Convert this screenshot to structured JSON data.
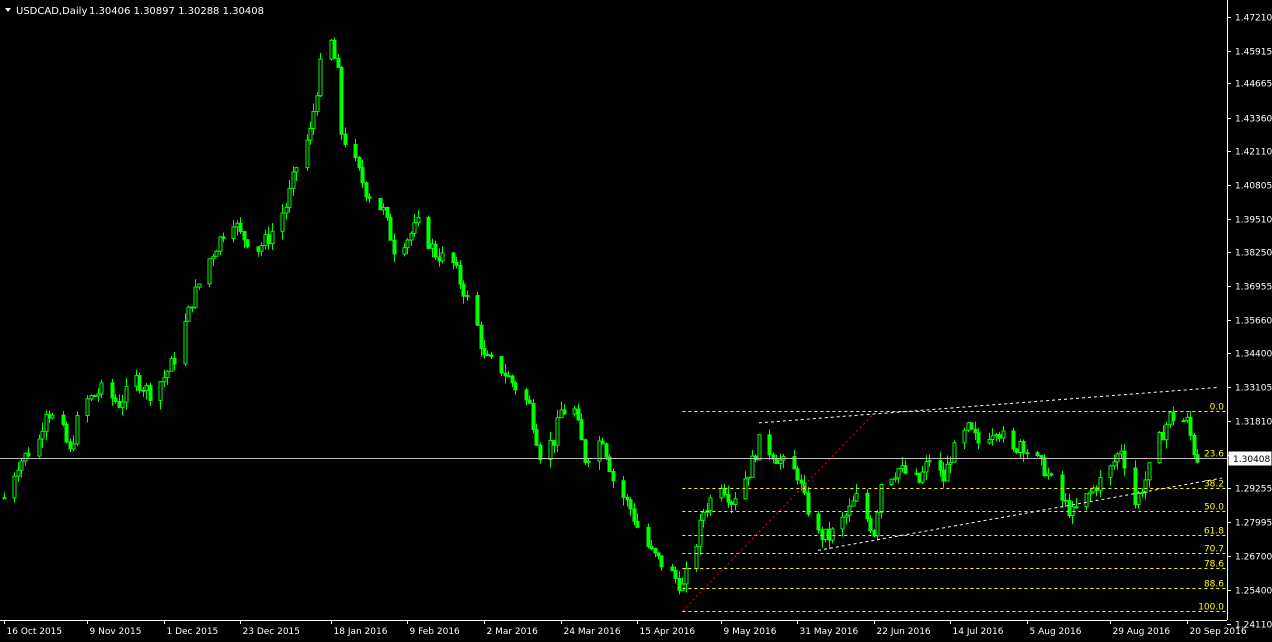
{
  "header": {
    "symbol": "USDCAD,Daily",
    "ohlc": "1.30406 1.30897 1.30288 1.30408",
    "menu_icon": "triangle-down-icon"
  },
  "colors": {
    "background": "#000000",
    "axis": "#ffffff",
    "bull_candle": "#00ff00",
    "fib": "#ffff00",
    "trendline": "#ffffff",
    "fib_base": "#ff0000",
    "current_price_line": "#c0c0c0"
  },
  "price_tag": "1.30408",
  "chart_data": {
    "type": "candlestick",
    "title": "",
    "xlabel": "",
    "ylabel": "",
    "ylim": [
      1.2425,
      1.4765
    ],
    "grid": false,
    "y_ticks": [
      "1.47210",
      "1.45915",
      "1.44665",
      "1.43360",
      "1.42110",
      "1.40805",
      "1.39510",
      "1.38250",
      "1.36955",
      "1.35660",
      "1.34400",
      "1.33105",
      "1.31810",
      "1.30515",
      "1.29255",
      "1.27995",
      "1.26700",
      "1.25400",
      "1.24110"
    ],
    "x_ticks": [
      "16 Oct 2015",
      "9 Nov 2015",
      "1 Dec 2015",
      "23 Dec 2015",
      "18 Jan 2016",
      "9 Feb 2016",
      "2 Mar 2016",
      "24 Mar 2016",
      "15 Apr 2016",
      "9 May 2016",
      "31 May 2016",
      "22 Jun 2016",
      "14 Jul 2016",
      "5 Aug 2016",
      "29 Aug 2016",
      "20 Sep 2016"
    ],
    "price_path": [
      [
        "16 Oct 2015",
        1.289
      ],
      [
        "20 Oct 2015",
        1.302
      ],
      [
        "26 Oct 2015",
        1.311
      ],
      [
        "28 Oct 2015",
        1.323
      ],
      [
        "2 Nov 2015",
        1.314
      ],
      [
        "4 Nov 2015",
        1.306
      ],
      [
        "6 Nov 2015",
        1.318
      ],
      [
        "9 Nov 2015",
        1.326
      ],
      [
        "13 Nov 2015",
        1.33
      ],
      [
        "18 Nov 2015",
        1.325
      ],
      [
        "23 Nov 2015",
        1.334
      ],
      [
        "27 Nov 2015",
        1.329
      ],
      [
        "1 Dec 2015",
        1.335
      ],
      [
        "4 Dec 2015",
        1.342
      ],
      [
        "9 Dec 2015",
        1.364
      ],
      [
        "14 Dec 2015",
        1.38
      ],
      [
        "18 Dec 2015",
        1.39
      ],
      [
        "21 Dec 2015",
        1.395
      ],
      [
        "23 Dec 2015",
        1.389
      ],
      [
        "28 Dec 2015",
        1.384
      ],
      [
        "31 Dec 2015",
        1.388
      ],
      [
        "5 Jan 2016",
        1.4
      ],
      [
        "8 Jan 2016",
        1.415
      ],
      [
        "12 Jan 2016",
        1.428
      ],
      [
        "15 Jan 2016",
        1.453
      ],
      [
        "18 Jan 2016",
        1.462
      ],
      [
        "20 Jan 2016",
        1.45
      ],
      [
        "21 Jan 2016",
        1.428
      ],
      [
        "25 Jan 2016",
        1.416
      ],
      [
        "28 Jan 2016",
        1.406
      ],
      [
        "2 Feb 2016",
        1.398
      ],
      [
        "5 Feb 2016",
        1.384
      ],
      [
        "9 Feb 2016",
        1.388
      ],
      [
        "12 Feb 2016",
        1.393
      ],
      [
        "17 Feb 2016",
        1.382
      ],
      [
        "22 Feb 2016",
        1.378
      ],
      [
        "25 Feb 2016",
        1.368
      ],
      [
        "29 Feb 2016",
        1.354
      ],
      [
        "2 Mar 2016",
        1.342
      ],
      [
        "7 Mar 2016",
        1.338
      ],
      [
        "10 Mar 2016",
        1.333
      ],
      [
        "15 Mar 2016",
        1.324
      ],
      [
        "18 Mar 2016",
        1.306
      ],
      [
        "22 Mar 2016",
        1.311
      ],
      [
        "24 Mar 2016",
        1.322
      ],
      [
        "28 Mar 2016",
        1.322
      ],
      [
        "31 Mar 2016",
        1.304
      ],
      [
        "5 Apr 2016",
        1.312
      ],
      [
        "8 Apr 2016",
        1.296
      ],
      [
        "13 Apr 2016",
        1.285
      ],
      [
        "15 Apr 2016",
        1.278
      ],
      [
        "19 Apr 2016",
        1.268
      ],
      [
        "25 Apr 2016",
        1.26
      ],
      [
        "28 Apr 2016",
        1.255
      ],
      [
        "2 May 2016",
        1.272
      ],
      [
        "4 May 2016",
        1.284
      ],
      [
        "9 May 2016",
        1.295
      ],
      [
        "12 May 2016",
        1.288
      ],
      [
        "17 May 2016",
        1.299
      ],
      [
        "20 May 2016",
        1.31
      ],
      [
        "24 May 2016",
        1.306
      ],
      [
        "26 May 2016",
        1.303
      ],
      [
        "31 May 2016",
        1.298
      ],
      [
        "2 Jun 2016",
        1.288
      ],
      [
        "6 Jun 2016",
        1.275
      ],
      [
        "9 Jun 2016",
        1.274
      ],
      [
        "14 Jun 2016",
        1.282
      ],
      [
        "17 Jun 2016",
        1.289
      ],
      [
        "22 Jun 2016",
        1.276
      ],
      [
        "24 Jun 2016",
        1.295
      ],
      [
        "29 Jun 2016",
        1.3
      ],
      [
        "5 Jul 2016",
        1.295
      ],
      [
        "8 Jul 2016",
        1.304
      ],
      [
        "12 Jul 2016",
        1.296
      ],
      [
        "14 Jul 2016",
        1.305
      ],
      [
        "19 Jul 2016",
        1.315
      ],
      [
        "22 Jul 2016",
        1.31
      ],
      [
        "27 Jul 2016",
        1.316
      ],
      [
        "1 Aug 2016",
        1.306
      ],
      [
        "3 Aug 2016",
        1.311
      ],
      [
        "5 Aug 2016",
        1.307
      ],
      [
        "10 Aug 2016",
        1.3
      ],
      [
        "15 Aug 2016",
        1.288
      ],
      [
        "18 Aug 2016",
        1.283
      ],
      [
        "22 Aug 2016",
        1.289
      ],
      [
        "25 Aug 2016",
        1.294
      ],
      [
        "29 Aug 2016",
        1.3
      ],
      [
        "1 Sep 2016",
        1.308
      ],
      [
        "5 Sep 2016",
        1.287
      ],
      [
        "8 Sep 2016",
        1.296
      ],
      [
        "12 Sep 2016",
        1.311
      ],
      [
        "15 Sep 2016",
        1.32
      ],
      [
        "20 Sep 2016",
        1.318
      ],
      [
        "22 Sep 2016",
        1.307
      ],
      [
        "23 Sep 2016",
        1.304
      ]
    ],
    "fibonacci": {
      "high": 1.3219,
      "low": 1.2459,
      "levels": [
        "0.0",
        "23.6",
        "38.2",
        "50.0",
        "61.8",
        "70.7",
        "78.6",
        "88.6",
        "100.0"
      ]
    },
    "trendlines": [
      {
        "from": [
          "20 May 2016",
          1.3175
        ],
        "to": [
          "29 Sep 2016",
          1.331
        ]
      },
      {
        "from": [
          "6 Jun 2016",
          1.269
        ],
        "to": [
          "30 Sep 2016",
          1.2965
        ]
      }
    ],
    "fib_anchor_line": {
      "from": [
        "28 Apr 2016",
        1.2459
      ],
      "to": [
        "22 Jun 2016",
        1.321
      ]
    },
    "current_price": 1.30408
  }
}
